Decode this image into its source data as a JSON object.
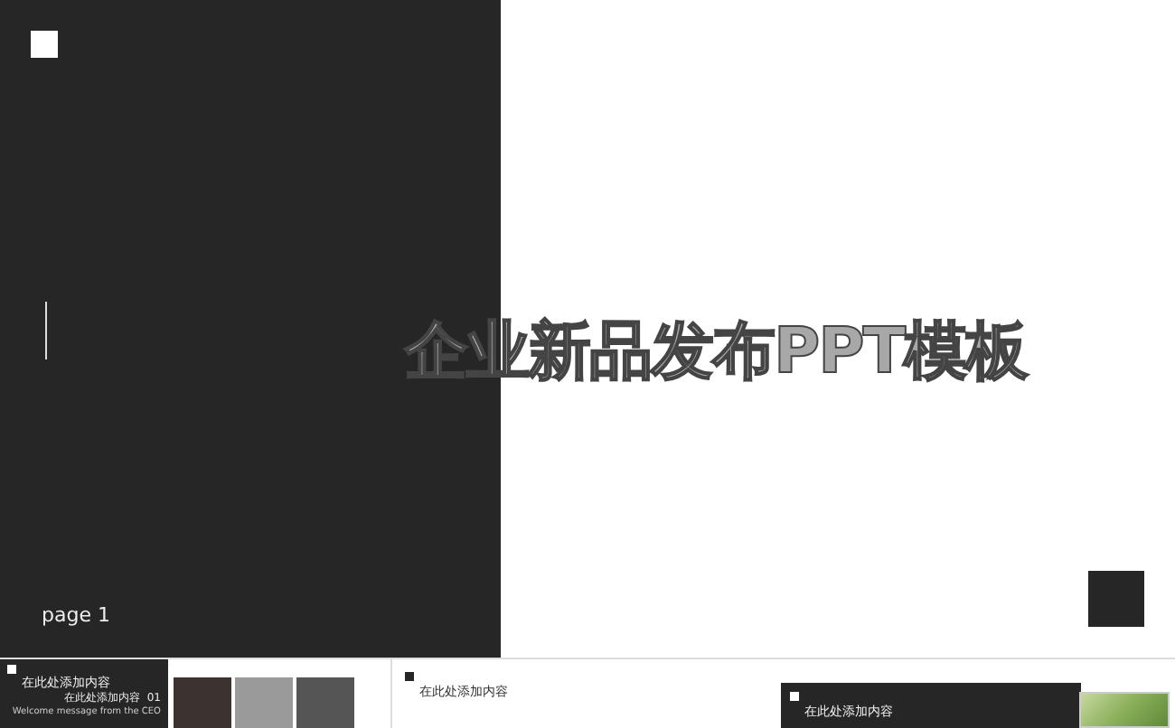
{
  "slide": {
    "title": "企业新品发布PPT模板",
    "page_label": "page 1"
  },
  "thumbnails": [
    {
      "kind": "dark-split",
      "heading": "在此处添加内容",
      "subheading": "在此处添加内容",
      "number": "01",
      "caption": "Welcome message from the CEO"
    },
    {
      "kind": "light",
      "heading": "在此处添加内容"
    },
    {
      "kind": "dark-photo",
      "heading": "在此处添加内容"
    }
  ]
}
